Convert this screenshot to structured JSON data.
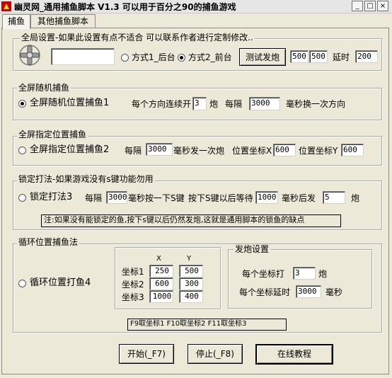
{
  "window": {
    "title": "幽灵网_通用捕鱼脚本 V1.3   可以用于百分之90的捕鱼游戏",
    "btn_min": "_",
    "btn_max": "□",
    "btn_close": "×"
  },
  "tabs": [
    "捕鱼",
    "其他捕鱼脚本"
  ],
  "global": {
    "legend": "全局设置-如果此设置有点不适合 可以联系作者进行定制修改..",
    "text_box": "",
    "mode1": "方式1_后台",
    "mode2": "方式2_前台",
    "selected_mode": "mode2",
    "test_button": "测试发炮",
    "val_a": "500",
    "val_b": "500",
    "delay_label": "延时",
    "delay_value": "200"
  },
  "random": {
    "legend": "全屏随机捕鱼",
    "radio_label": "全屏随机位置捕鱼1",
    "selected": true,
    "lbl_each": "每个方向连续开",
    "shots": "3",
    "lbl_shot": "炮",
    "lbl_every": "每隔",
    "interval": "3000",
    "lbl_ms": "毫秒换一次方向"
  },
  "fixed": {
    "legend": "全屏指定位置捕鱼",
    "radio_label": "全屏指定位置捕鱼2",
    "selected": false,
    "lbl_every": "每隔",
    "interval": "3000",
    "lbl_ms": "毫秒发一次炮",
    "lbl_x": "位置坐标X",
    "x": "600",
    "lbl_y": "位置坐标Y",
    "y": "600"
  },
  "lock": {
    "legend": "锁定打法-如果游戏没有s键功能勿用",
    "radio_label": "锁定打法3",
    "selected": false,
    "lbl_every": "每隔",
    "interval": "3000",
    "lbl_ms": "毫秒按一下S键",
    "lbl_after": "按下S键以后等待",
    "wait": "1000",
    "lbl_fire": "毫秒后发",
    "shots": "5",
    "lbl_shot": "炮",
    "note": "注:如果没有能锁定的鱼,按下s键以后仍然发炮,这就是通用脚本的锁鱼的缺点"
  },
  "loop": {
    "legend": "循环位置捕鱼法",
    "radio_label": "循环位置打鱼4",
    "selected": false,
    "col_x": "X",
    "col_y": "Y",
    "rows": [
      {
        "label": "坐标1",
        "x": "250",
        "y": "500"
      },
      {
        "label": "坐标2",
        "x": "600",
        "y": "300"
      },
      {
        "label": "坐标3",
        "x": "1000",
        "y": "400"
      }
    ],
    "fire_legend": "发炮设置",
    "lbl_each_coord": "每个坐标打",
    "shots": "3",
    "lbl_shot": "炮",
    "lbl_each_delay": "每个坐标延时",
    "delay": "3000",
    "lbl_ms": "毫秒",
    "hotkeys": "F9取坐标1 F10取坐标2 F11取坐标3"
  },
  "actions": {
    "start": "开始(_F7)",
    "stop": "停止(_F8)",
    "tutorial": "在线教程"
  }
}
